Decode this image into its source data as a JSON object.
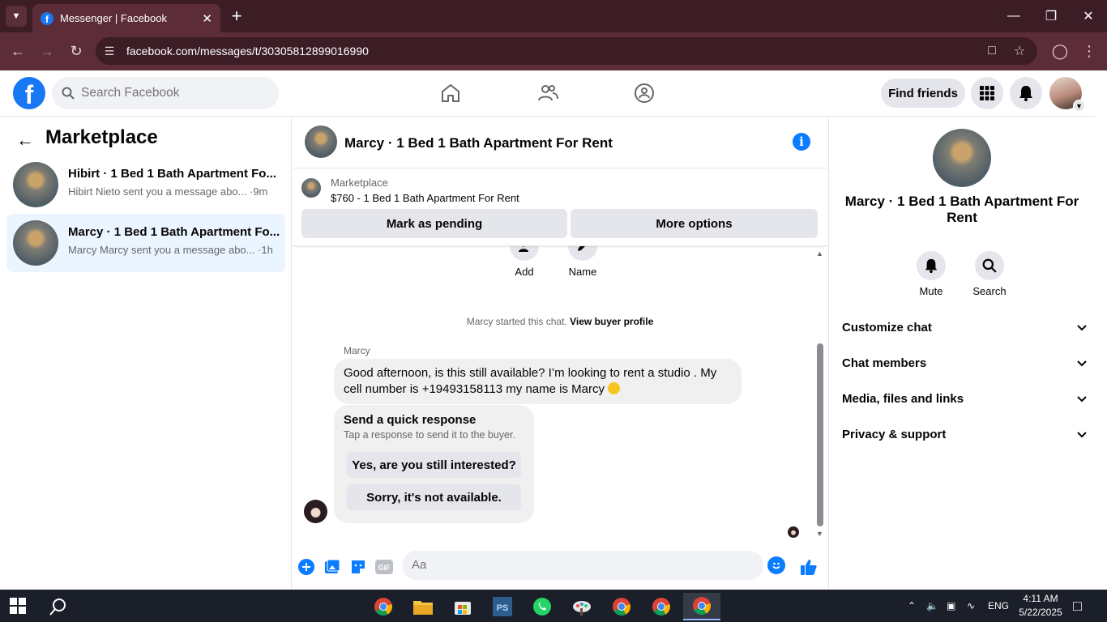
{
  "browser": {
    "tab_title": "Messenger | Facebook",
    "url": "facebook.com/messages/t/30305812899016990"
  },
  "fb_header": {
    "search_placeholder": "Search Facebook",
    "find_friends_label": "Find friends"
  },
  "left_panel": {
    "title": "Marketplace",
    "conversations": [
      {
        "title": "Hibirt · 1 Bed 1 Bath Apartment Fo...",
        "subtitle": "Hibirt Nieto sent you a message abo... ·9m",
        "active": false
      },
      {
        "title": "Marcy · 1 Bed 1 Bath Apartment Fo...",
        "subtitle": "Marcy Marcy sent you a message abo... ·1h",
        "active": true
      }
    ]
  },
  "chat": {
    "header_title": "Marcy · 1 Bed 1 Bath Apartment For Rent",
    "listing": {
      "category": "Marketplace",
      "price_title": "$760 - 1 Bed 1 Bath Apartment For Rent",
      "mark_pending_label": "Mark as pending",
      "more_options_label": "More options"
    },
    "actions": {
      "add_label": "Add",
      "name_label": "Name"
    },
    "started_text": "Marcy started this chat.",
    "view_profile_label": "View buyer profile",
    "sender_name": "Marcy",
    "message": "Good afternoon, is this still available? I’m looking to rent a studio . My cell number is +19493158113 my name is Marcy",
    "quick_response": {
      "title": "Send a quick response",
      "subtitle": "Tap a response to send it to the buyer.",
      "option_1": "Yes, are you still interested?",
      "option_2": "Sorry, it's not available."
    },
    "composer_placeholder": "Aa"
  },
  "right_panel": {
    "name": "Marcy · 1 Bed 1 Bath Apartment For Rent",
    "mute_label": "Mute",
    "search_label": "Search",
    "sections": [
      "Customize chat",
      "Chat members",
      "Media, files and links",
      "Privacy & support"
    ]
  },
  "taskbar": {
    "language": "ENG",
    "time": "4:11 AM",
    "date": "5/22/2025"
  },
  "colors": {
    "browser_dark": "#3c1d25",
    "browser_toolbar": "#5c2d39",
    "facebook_blue": "#1877f2",
    "messenger_blue": "#0a7cff",
    "active_conversation_bg": "#ebf5ff"
  }
}
